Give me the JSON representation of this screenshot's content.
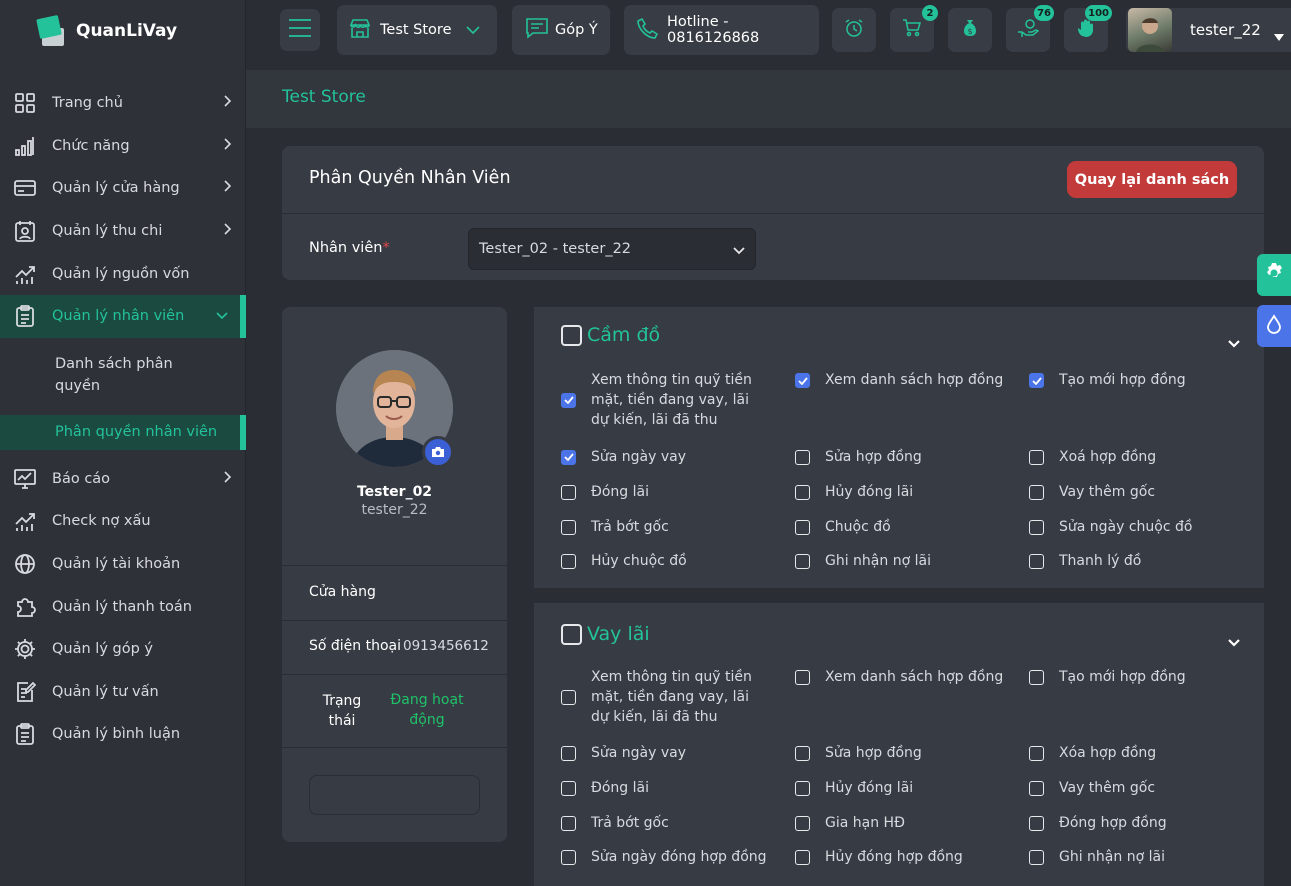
{
  "app": {
    "name": "QuanLiVay"
  },
  "colors": {
    "accent": "#23c29a",
    "danger": "#c23a3a",
    "checkbox": "#4a74e8",
    "active_status": "#1fc26a"
  },
  "topbar": {
    "store": "Test Store",
    "feedback": "Góp Ý",
    "hotline": "Hotline - 0816126868",
    "badges": {
      "cart": "2",
      "money": "76",
      "hand": "100"
    },
    "user": "tester_22"
  },
  "sidebar": {
    "items": [
      {
        "label": "Trang chủ",
        "icon": "grid-icon"
      },
      {
        "label": "Chức năng",
        "icon": "signal-bars-icon"
      },
      {
        "label": "Quản lý cửa hàng",
        "icon": "card-icon"
      },
      {
        "label": "Quản lý thu chi",
        "icon": "calendar-user-icon"
      },
      {
        "label": "Quản lý nguồn vốn",
        "icon": "chart-up-icon"
      },
      {
        "label": "Quản lý nhân viên",
        "icon": "clipboard-icon"
      },
      {
        "label": "Báo cáo",
        "icon": "monitor-chart-icon"
      },
      {
        "label": "Check nợ xấu",
        "icon": "chart-up-icon"
      },
      {
        "label": "Quản lý tài khoản",
        "icon": "globe-icon"
      },
      {
        "label": "Quản lý thanh toán",
        "icon": "puzzle-icon"
      },
      {
        "label": "Quản lý góp ý",
        "icon": "gear-icon"
      },
      {
        "label": "Quản lý tư vấn",
        "icon": "edit-doc-icon"
      },
      {
        "label": "Quản lý bình luận",
        "icon": "clipboard-icon"
      }
    ],
    "sub": [
      "Danh sách phân quyền",
      "Phân quyền nhân viên"
    ]
  },
  "breadcrumb": "Test Store",
  "header": {
    "title": "Phân Quyền Nhân Viên",
    "back_label": "Quay lại danh sách",
    "employee_label": "Nhân viên",
    "required_mark": "*",
    "employee_value": "Tester_02 - tester_22"
  },
  "profile": {
    "name": "Tester_02",
    "username": "tester_22",
    "store_label": "Cửa hàng",
    "phone_label": "Số điện thoại",
    "phone": "0913456612",
    "status_label": "Trạng thái",
    "status": "Đang hoạt động"
  },
  "sections": [
    {
      "title": "Cầm đồ",
      "perms": [
        {
          "label": "Xem thông tin quỹ tiền mặt, tiền đang vay, lãi dự kiến, lãi đã thu",
          "checked": true
        },
        {
          "label": "Xem danh sách hợp đồng",
          "checked": true
        },
        {
          "label": "Tạo mới hợp đồng",
          "checked": true
        },
        {
          "label": "Sửa ngày vay",
          "checked": true
        },
        {
          "label": "Sửa hợp đồng",
          "checked": false
        },
        {
          "label": "Xoá hợp đồng",
          "checked": false
        },
        {
          "label": "Đóng lãi",
          "checked": false
        },
        {
          "label": "Hủy đóng lãi",
          "checked": false
        },
        {
          "label": "Vay thêm gốc",
          "checked": false
        },
        {
          "label": "Trả bớt gốc",
          "checked": false
        },
        {
          "label": "Chuộc đồ",
          "checked": false
        },
        {
          "label": "Sửa ngày chuộc đồ",
          "checked": false
        },
        {
          "label": "Hủy chuộc đồ",
          "checked": false
        },
        {
          "label": "Ghi nhận nợ lãi",
          "checked": false
        },
        {
          "label": "Thanh lý đồ",
          "checked": false
        }
      ]
    },
    {
      "title": "Vay lãi",
      "perms": [
        {
          "label": "Xem thông tin quỹ tiền mặt, tiền đang vay, lãi dự kiến, lãi đã thu",
          "checked": false
        },
        {
          "label": "Xem danh sách hợp đồng",
          "checked": false
        },
        {
          "label": "Tạo mới hợp đồng",
          "checked": false
        },
        {
          "label": "Sửa ngày vay",
          "checked": false
        },
        {
          "label": "Sửa hợp đồng",
          "checked": false
        },
        {
          "label": "Xóa hợp đồng",
          "checked": false
        },
        {
          "label": "Đóng lãi",
          "checked": false
        },
        {
          "label": "Hủy đóng lãi",
          "checked": false
        },
        {
          "label": "Vay thêm gốc",
          "checked": false
        },
        {
          "label": "Trả bớt gốc",
          "checked": false
        },
        {
          "label": "Gia hạn HĐ",
          "checked": false
        },
        {
          "label": "Đóng hợp đồng",
          "checked": false
        },
        {
          "label": "Sửa ngày đóng hợp đồng",
          "checked": false
        },
        {
          "label": "Hủy đóng hợp đồng",
          "checked": false
        },
        {
          "label": "Ghi nhận nợ lãi",
          "checked": false
        }
      ]
    }
  ]
}
